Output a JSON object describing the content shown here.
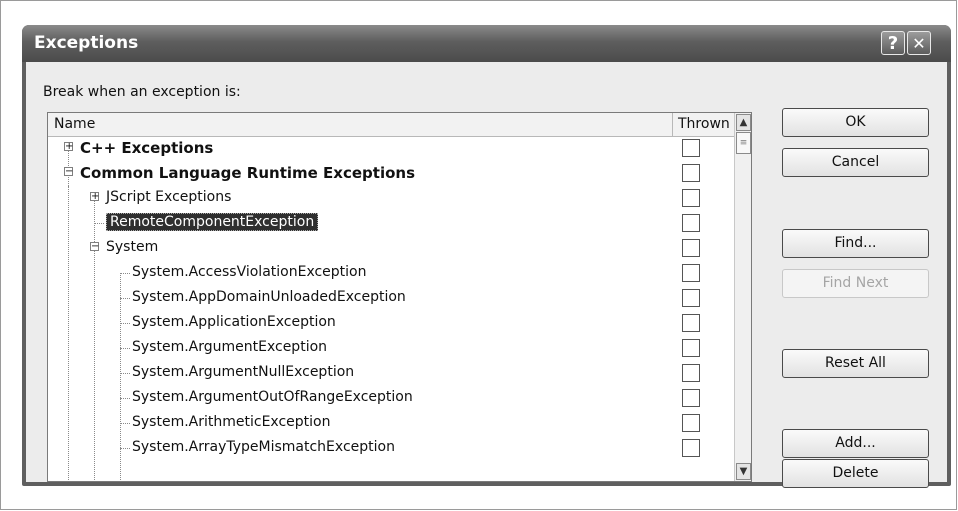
{
  "dialog": {
    "title": "Exceptions",
    "help_glyph": "?",
    "close_glyph": "✕",
    "prompt": "Break when an exception is:"
  },
  "list": {
    "columns": {
      "name": "Name",
      "thrown": "Thrown"
    },
    "rows": [
      {
        "label": "C++ Exceptions",
        "level": 0,
        "expander": "+",
        "bold": true,
        "selected": false
      },
      {
        "label": "Common Language Runtime Exceptions",
        "level": 0,
        "expander": "-",
        "bold": true,
        "selected": false
      },
      {
        "label": "JScript Exceptions",
        "level": 1,
        "expander": "+",
        "bold": false,
        "selected": false
      },
      {
        "label": "RemoteComponentException",
        "level": 1,
        "expander": "",
        "bold": false,
        "selected": true
      },
      {
        "label": "System",
        "level": 1,
        "expander": "-",
        "bold": false,
        "selected": false
      },
      {
        "label": "System.AccessViolationException",
        "level": 2,
        "expander": "",
        "bold": false,
        "selected": false
      },
      {
        "label": "System.AppDomainUnloadedException",
        "level": 2,
        "expander": "",
        "bold": false,
        "selected": false
      },
      {
        "label": "System.ApplicationException",
        "level": 2,
        "expander": "",
        "bold": false,
        "selected": false
      },
      {
        "label": "System.ArgumentException",
        "level": 2,
        "expander": "",
        "bold": false,
        "selected": false
      },
      {
        "label": "System.ArgumentNullException",
        "level": 2,
        "expander": "",
        "bold": false,
        "selected": false
      },
      {
        "label": "System.ArgumentOutOfRangeException",
        "level": 2,
        "expander": "",
        "bold": false,
        "selected": false
      },
      {
        "label": "System.ArithmeticException",
        "level": 2,
        "expander": "",
        "bold": false,
        "selected": false
      },
      {
        "label": "System.ArrayTypeMismatchException",
        "level": 2,
        "expander": "",
        "bold": false,
        "selected": false
      }
    ]
  },
  "buttons": {
    "ok": "OK",
    "cancel": "Cancel",
    "find": "Find...",
    "find_next": "Find Next",
    "reset_all": "Reset All",
    "add": "Add...",
    "delete": "Delete"
  },
  "colors": {
    "title_bar": "#5e5e5e",
    "selection": "#2f2f2f",
    "dialog_face": "#ececec"
  }
}
